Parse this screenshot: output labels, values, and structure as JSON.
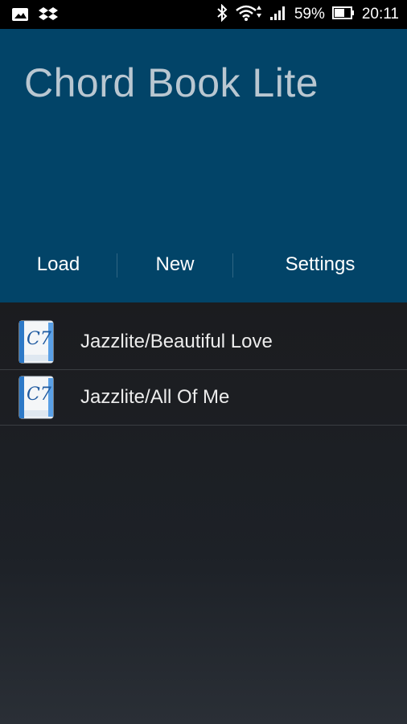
{
  "status_bar": {
    "left_icons": [
      "gallery-icon",
      "dropbox-icon"
    ],
    "battery_percent": "59%",
    "time": "20:11"
  },
  "app": {
    "title": "Chord Book Lite"
  },
  "actions": {
    "load": "Load",
    "new": "New",
    "settings": "Settings"
  },
  "files": [
    {
      "label": "Jazzlite/Beautiful Love",
      "icon": "chord-file-icon",
      "icon_text": "C7"
    },
    {
      "label": "Jazzlite/All Of Me",
      "icon": "chord-file-icon",
      "icon_text": "C7"
    }
  ],
  "colors": {
    "header_bg": "#024468",
    "title": "#b9c7d1"
  }
}
